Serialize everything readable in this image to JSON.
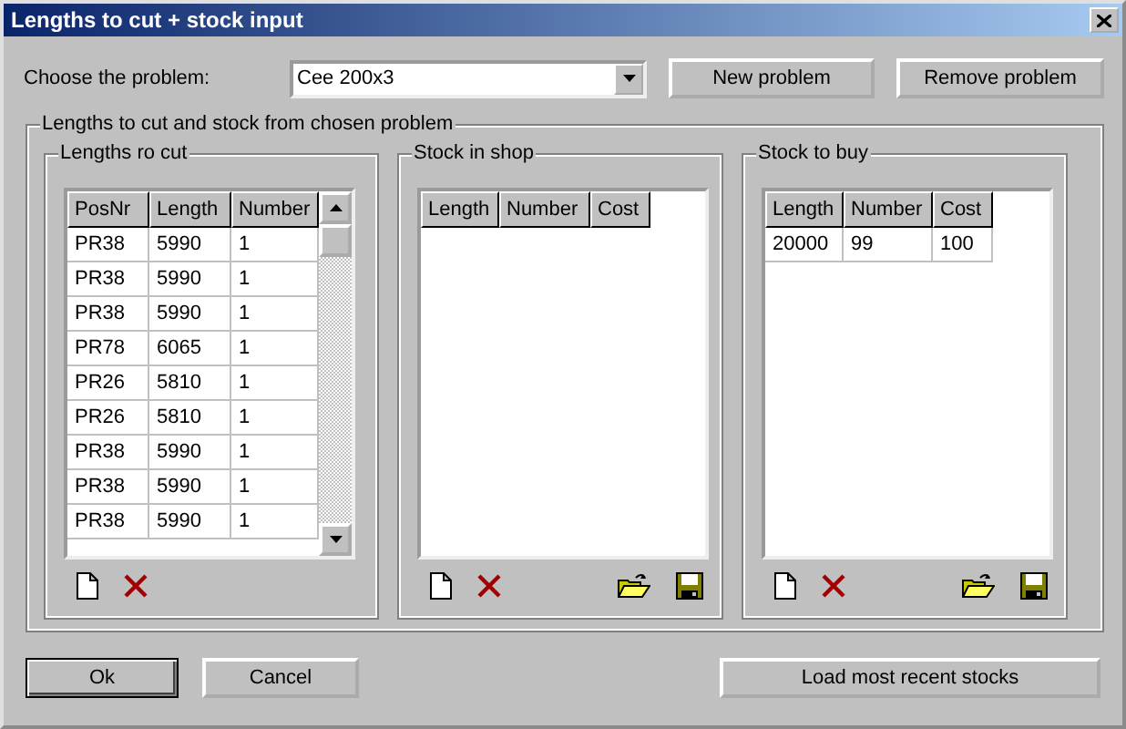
{
  "window": {
    "title": "Lengths to cut + stock input"
  },
  "problem": {
    "label": "Choose the problem:",
    "value": "Cee 200x3"
  },
  "top_buttons": [
    "New problem",
    "Remove problem"
  ],
  "group": {
    "title": "Lengths to cut and stock from chosen problem",
    "panels": [
      {
        "title": "Lengths ro cut",
        "columns": [
          "PosNr",
          "Length",
          "Number"
        ],
        "scrollable": true,
        "file_buttons": false,
        "rows": [
          [
            "PR38",
            "5990",
            "1"
          ],
          [
            "PR38",
            "5990",
            "1"
          ],
          [
            "PR38",
            "5990",
            "1"
          ],
          [
            "PR78",
            "6065",
            "1"
          ],
          [
            "PR26",
            "5810",
            "1"
          ],
          [
            "PR26",
            "5810",
            "1"
          ],
          [
            "PR38",
            "5990",
            "1"
          ],
          [
            "PR38",
            "5990",
            "1"
          ],
          [
            "PR38",
            "5990",
            "1"
          ]
        ]
      },
      {
        "title": "Stock in shop",
        "columns": [
          "Length",
          "Number",
          "Cost"
        ],
        "scrollable": false,
        "file_buttons": true
      },
      {
        "title": "Stock to buy",
        "columns": [
          "Length",
          "Number",
          "Cost"
        ],
        "scrollable": false,
        "file_buttons": true,
        "rows": [
          [
            "20000",
            "99",
            "100"
          ]
        ]
      }
    ]
  },
  "bottom_buttons": [
    {
      "label": "Ok",
      "default": true
    },
    {
      "label": "Cancel",
      "default": false
    },
    {
      "label": "Load most recent stocks",
      "default": false
    }
  ]
}
